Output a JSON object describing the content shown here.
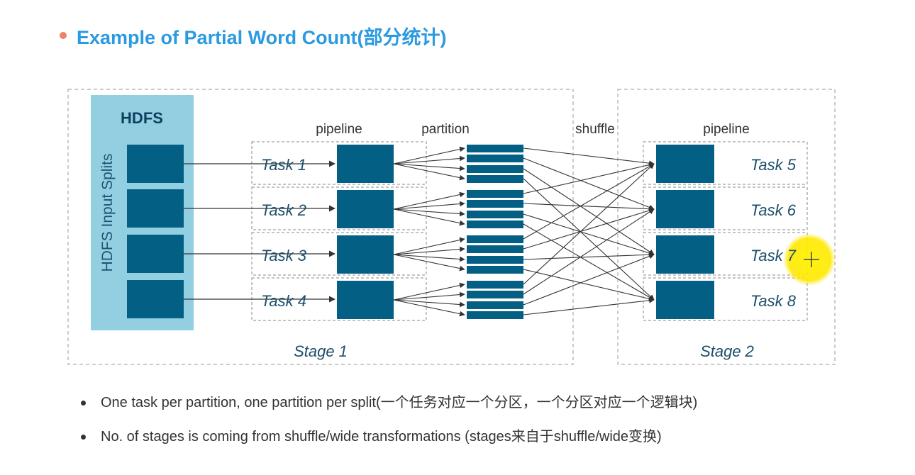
{
  "title": {
    "text": "Example of Partial Word Count(部分统计)"
  },
  "diagram": {
    "hdfs_label": "HDFS",
    "splits_label": "HDFS Input Splits",
    "pipeline_label_1": "pipeline",
    "partition_label": "partition",
    "shuffle_label": "shuffle",
    "pipeline_label_2": "pipeline",
    "stage1_tasks": [
      "Task 1",
      "Task 2",
      "Task 3",
      "Task 4"
    ],
    "stage2_tasks": [
      "Task 5",
      "Task 6",
      "Task 7",
      "Task 8"
    ],
    "stage1_label": "Stage 1",
    "stage2_label": "Stage 2",
    "colors": {
      "block": "#045f84",
      "hdfs_bg": "#92cfe1",
      "title": "#2b9ae0",
      "cursor_highlight": "#fff200"
    }
  },
  "bullets": [
    "One task per partition, one partition per split(一个任务对应一个分区，一个分区对应一个逻辑块)",
    "No. of stages is coming from shuffle/wide transformations (stages来自于shuffle/wide变换)"
  ]
}
